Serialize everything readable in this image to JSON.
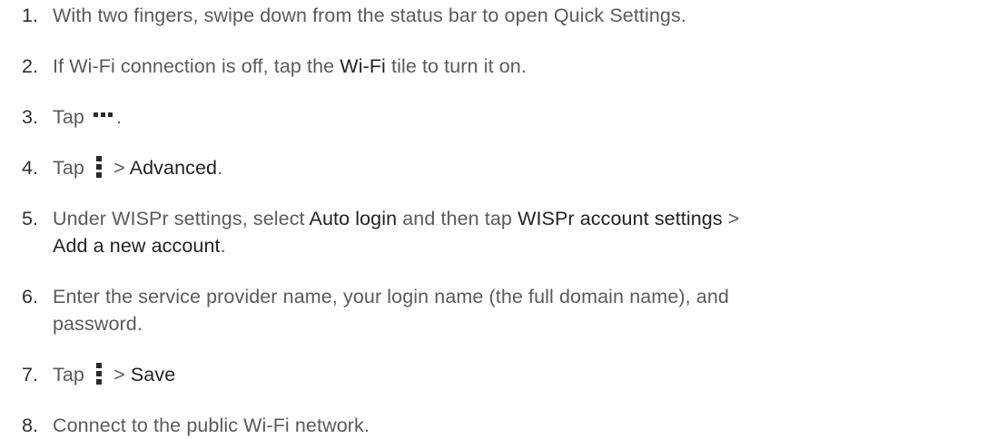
{
  "steps": [
    {
      "num": "1.",
      "text": "With two fingers, swipe down from the status bar to open Quick Settings."
    },
    {
      "num": "2.",
      "pre": "If Wi-Fi connection is off, tap the ",
      "bold": "Wi-Fi",
      "post": " tile to turn it on."
    },
    {
      "num": "3.",
      "pre": "Tap ",
      "icon": "more-horizontal-icon",
      "post": "."
    },
    {
      "num": "4.",
      "pre": "Tap ",
      "icon": "more-vertical-icon",
      "mid": " > ",
      "bold": "Advanced",
      "post": "."
    },
    {
      "num": "5.",
      "pre": "Under WISPr settings, select ",
      "bold1": "Auto login",
      "mid": " and then tap ",
      "bold2": "WISPr account settings",
      "sep": " > ",
      "bold3": "Add a new account",
      "post": "."
    },
    {
      "num": "6.",
      "line1": "Enter the service provider name, your login name (the full domain name), and",
      "line2": "password."
    },
    {
      "num": "7.",
      "pre": "Tap ",
      "icon": "more-vertical-icon",
      "mid": " > ",
      "bold": "Save"
    },
    {
      "num": "8.",
      "text": "Connect to the public Wi-Fi network."
    }
  ]
}
